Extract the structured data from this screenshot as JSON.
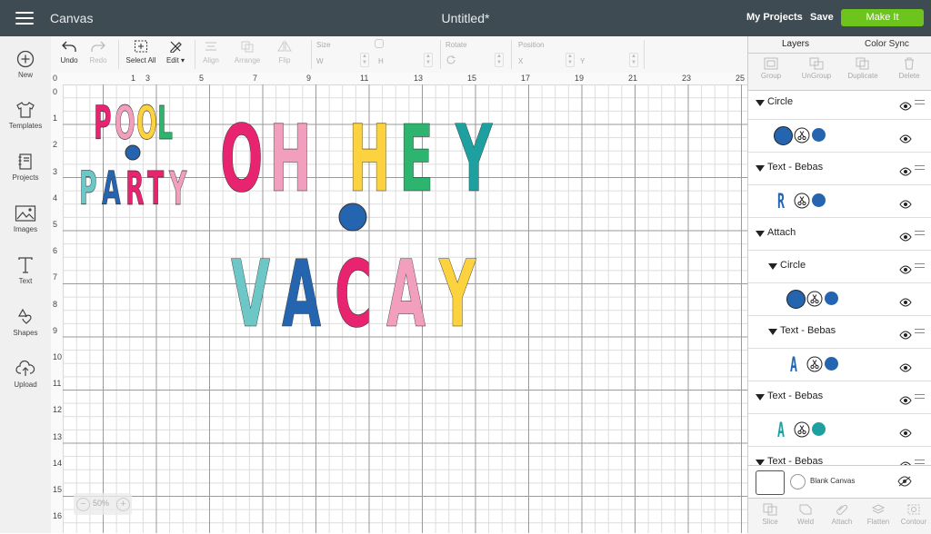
{
  "header": {
    "app_title": "Canvas",
    "doc_title": "Untitled*",
    "my_projects": "My Projects",
    "save": "Save",
    "make_it": "Make It"
  },
  "leftbar": {
    "items": [
      {
        "label": "New",
        "icon": "plus-circle-icon"
      },
      {
        "label": "Templates",
        "icon": "shirt-icon"
      },
      {
        "label": "Projects",
        "icon": "notebook-icon"
      },
      {
        "label": "Images",
        "icon": "image-icon"
      },
      {
        "label": "Text",
        "icon": "text-T-icon"
      },
      {
        "label": "Shapes",
        "icon": "shapes-icon"
      },
      {
        "label": "Upload",
        "icon": "cloud-upload-icon"
      }
    ]
  },
  "toolbar": {
    "undo": "Undo",
    "redo": "Redo",
    "select_all": "Select All",
    "edit": "Edit",
    "align": "Align",
    "arrange": "Arrange",
    "flip": "Flip",
    "size": "Size",
    "w": "W",
    "h": "H",
    "rotate": "Rotate",
    "position": "Position",
    "x": "X",
    "y": "Y"
  },
  "ruler": {
    "top": [
      "0",
      "1",
      "3",
      "5",
      "7",
      "9",
      "11",
      "13",
      "15",
      "17",
      "19",
      "21",
      "23",
      "25"
    ],
    "left": [
      "0",
      "1",
      "2",
      "3",
      "4",
      "5",
      "6",
      "7",
      "8",
      "9",
      "10",
      "11",
      "12",
      "13",
      "14",
      "15",
      "16"
    ]
  },
  "artwork": {
    "pool": [
      "P",
      "O",
      "O",
      "L"
    ],
    "party": [
      "P",
      "A",
      "R",
      "T",
      "Y"
    ],
    "oh_hey": [
      "O",
      "H",
      "H",
      "E",
      "Y"
    ],
    "vacay": [
      "V",
      "A",
      "C",
      "A",
      "Y"
    ],
    "colors": {
      "pink": "#e8236f",
      "light_pink": "#f29fbd",
      "yellow": "#fdd23f",
      "green": "#2db46e",
      "teal": "#1fa0a0",
      "light_teal": "#6cc7c6",
      "blue": "#2565b0"
    }
  },
  "zoom": {
    "value": "50%"
  },
  "panel": {
    "tabs": [
      "Layers",
      "Color Sync"
    ],
    "tools": [
      "Group",
      "UnGroup",
      "Duplicate",
      "Delete"
    ],
    "layers": [
      {
        "type": "group",
        "label": "Circle"
      },
      {
        "type": "item",
        "glyph": "",
        "color": "#2565b0"
      },
      {
        "type": "group",
        "label": "Text - Bebas"
      },
      {
        "type": "item",
        "glyph": "R",
        "color": "#2565b0"
      },
      {
        "type": "group",
        "label": "Attach"
      },
      {
        "type": "subgroup",
        "label": "Circle"
      },
      {
        "type": "subitem",
        "glyph": "",
        "color": "#2565b0"
      },
      {
        "type": "subgroup",
        "label": "Text - Bebas"
      },
      {
        "type": "subitem",
        "glyph": "A",
        "color": "#2565b0"
      },
      {
        "type": "group",
        "label": "Text - Bebas"
      },
      {
        "type": "item",
        "glyph": "A",
        "color": "#1fa0a0"
      },
      {
        "type": "group",
        "label": "Text - Bebas"
      }
    ],
    "blank_canvas": "Blank Canvas",
    "actions": [
      "Slice",
      "Weld",
      "Attach",
      "Flatten",
      "Contour"
    ]
  }
}
